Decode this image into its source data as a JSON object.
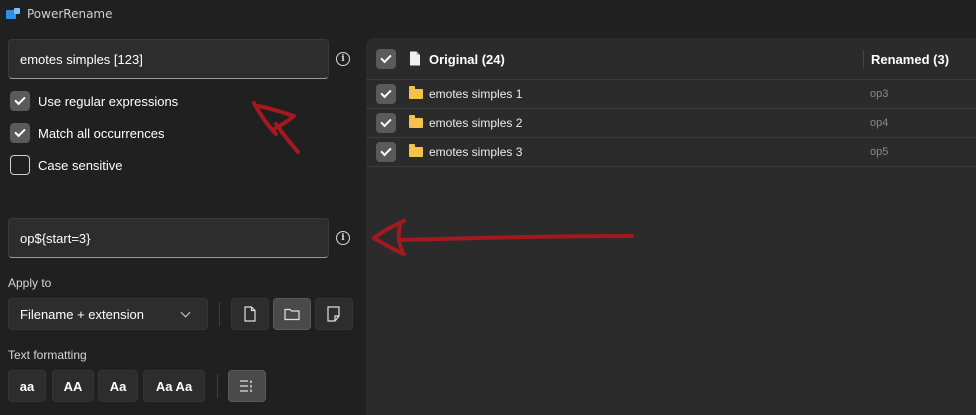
{
  "window": {
    "title": "PowerRename"
  },
  "search": {
    "value": "emotes simples [123]"
  },
  "options": [
    {
      "label": "Use regular expressions",
      "checked": true
    },
    {
      "label": "Match all occurrences",
      "checked": true
    },
    {
      "label": "Case sensitive",
      "checked": false
    }
  ],
  "replace": {
    "value": "op${start=3}"
  },
  "apply_to": {
    "label": "Apply to",
    "selected": "Filename + extension",
    "buttons": [
      "file-icon",
      "folder-icon",
      "file-subfolder-icon"
    ],
    "active_button": "folder-icon"
  },
  "text_formatting": {
    "label": "Text formatting",
    "buttons": [
      "aa",
      "AA",
      "Aa",
      "Aa Aa"
    ],
    "toggle": "list-format-icon"
  },
  "list": {
    "original_header": "Original (24)",
    "renamed_header": "Renamed (3)",
    "rows": [
      {
        "original": "emotes simples 1",
        "renamed": "op3"
      },
      {
        "original": "emotes simples 2",
        "renamed": "op4"
      },
      {
        "original": "emotes simples 3",
        "renamed": "op5"
      }
    ]
  },
  "colors": {
    "background": "#202020",
    "panel": "#2b2b2b",
    "folder": "#f2c14e",
    "annotation": "#a3191f"
  }
}
